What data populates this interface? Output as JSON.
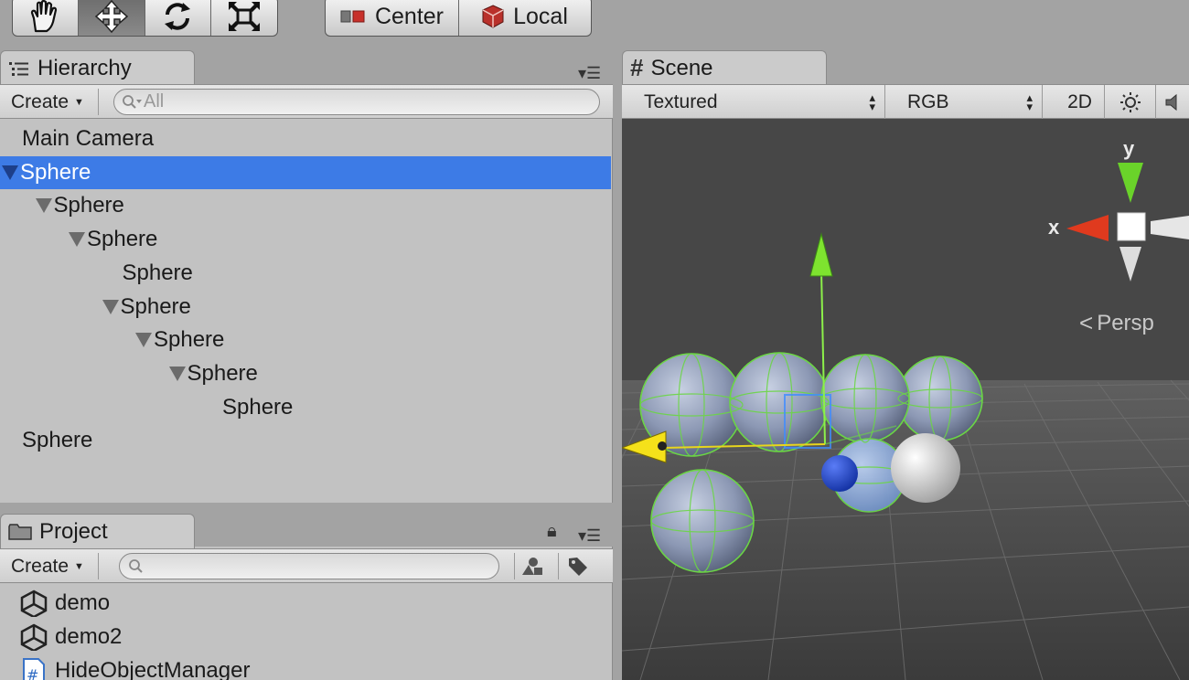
{
  "pivot": {
    "center_label": "Center",
    "local_label": "Local"
  },
  "hierarchy": {
    "tab_label": "Hierarchy",
    "create_label": "Create",
    "search_placeholder": "All",
    "items": [
      {
        "label": "Main Camera",
        "depth": 0,
        "expanded": false,
        "selected": false
      },
      {
        "label": "Sphere",
        "depth": 0,
        "expanded": true,
        "selected": true
      },
      {
        "label": "Sphere",
        "depth": 1,
        "expanded": true,
        "selected": false
      },
      {
        "label": "Sphere",
        "depth": 2,
        "expanded": true,
        "selected": false
      },
      {
        "label": "Sphere",
        "depth": 3,
        "expanded": false,
        "selected": false
      },
      {
        "label": "Sphere",
        "depth": 3,
        "expanded": true,
        "selected": false
      },
      {
        "label": "Sphere",
        "depth": 4,
        "expanded": true,
        "selected": false
      },
      {
        "label": "Sphere",
        "depth": 5,
        "expanded": true,
        "selected": false
      },
      {
        "label": "Sphere",
        "depth": 6,
        "expanded": false,
        "selected": false
      },
      {
        "label": "Sphere",
        "depth": 0,
        "expanded": false,
        "selected": false
      }
    ]
  },
  "project": {
    "tab_label": "Project",
    "create_label": "Create",
    "search_placeholder": "",
    "items": [
      {
        "label": "demo",
        "icon": "unity-icon"
      },
      {
        "label": "demo2",
        "icon": "unity-icon"
      },
      {
        "label": "HideObjectManager",
        "icon": "csharp-script-icon"
      }
    ]
  },
  "scene": {
    "tab_label": "Scene",
    "draw_mode": "Textured",
    "render_mode": "RGB",
    "view_2d_label": "2D",
    "projection_label": "Persp",
    "gizmo_x_label": "x",
    "gizmo_y_label": "y"
  },
  "colors": {
    "selection": "#3d7be6",
    "panel": "#c2c2c2",
    "scene_bg": "#474747",
    "axis_x": "#e03a1e",
    "axis_y": "#6ad32a",
    "axis_z": "#f5e11a"
  }
}
